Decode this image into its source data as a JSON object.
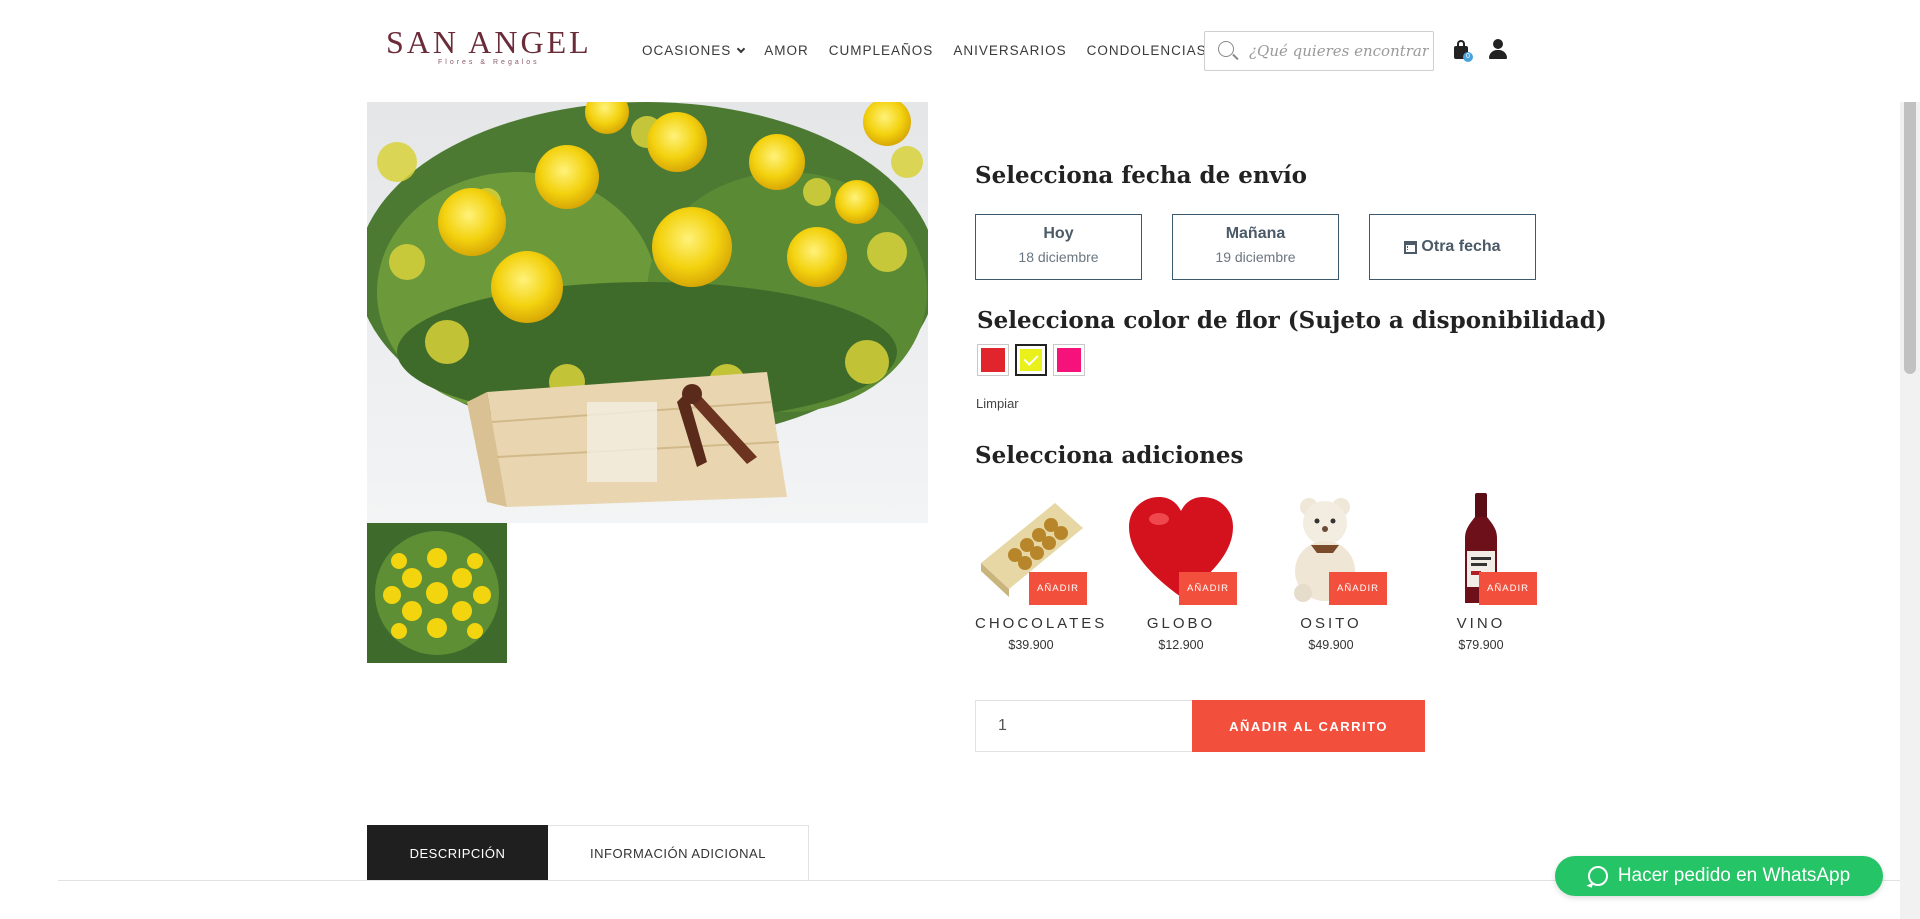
{
  "brand": {
    "name": "SAN ANGEL",
    "tagline": "Flores & Regalos"
  },
  "nav": {
    "items": [
      {
        "label": "OCASIONES",
        "has_dropdown": true
      },
      {
        "label": "AMOR"
      },
      {
        "label": "CUMPLEAÑOS"
      },
      {
        "label": "ANIVERSARIOS"
      },
      {
        "label": "CONDOLENCIAS"
      }
    ]
  },
  "search": {
    "placeholder": "¿Qué quieres encontrar?",
    "icon": "search-icon"
  },
  "cart": {
    "count": "0"
  },
  "delivery": {
    "title": "Selecciona fecha de envío",
    "options": [
      {
        "label": "Hoy",
        "date": "18 diciembre"
      },
      {
        "label": "Mañana",
        "date": "19 diciembre"
      },
      {
        "label": "Otra fecha",
        "icon": "calendar-icon"
      }
    ]
  },
  "flower_color": {
    "title": "Selecciona color de flor (Sujeto a disponibilidad)",
    "swatches": [
      {
        "name": "rojo",
        "color": "#e0262c",
        "selected": false
      },
      {
        "name": "amarillo",
        "color": "#eaf01a",
        "selected": true
      },
      {
        "name": "fucsia",
        "color": "#f5127a",
        "selected": false
      }
    ],
    "clear_label": "Limpiar"
  },
  "addons": {
    "title": "Selecciona adiciones",
    "add_label": "AÑADIR",
    "items": [
      {
        "name": "CHOCOLATES",
        "price": "$39.900"
      },
      {
        "name": "GLOBO",
        "price": "$12.900"
      },
      {
        "name": "OSITO",
        "price": "$49.900"
      },
      {
        "name": "VINO",
        "price": "$79.900"
      }
    ]
  },
  "purchase": {
    "quantity": "1",
    "add_to_cart_label": "AÑADIR AL CARRITO"
  },
  "tabs": [
    {
      "label": "DESCRIPCIÓN",
      "active": true
    },
    {
      "label": "INFORMACIÓN ADICIONAL",
      "active": false
    }
  ],
  "whatsapp": {
    "label": "Hacer pedido en WhatsApp",
    "color": "#25c466"
  },
  "colors": {
    "accent": "#f2503c",
    "brand": "#6b2c3a"
  }
}
